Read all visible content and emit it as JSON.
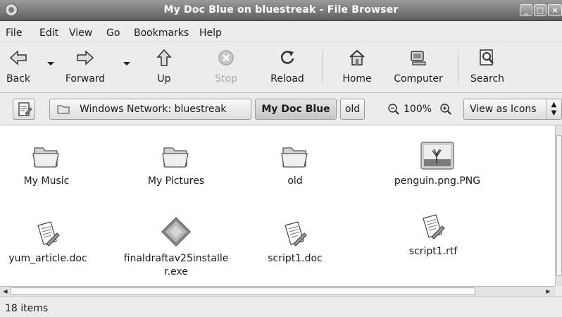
{
  "window": {
    "title": "My Doc Blue on bluestreak - File Browser"
  },
  "menubar": {
    "items": [
      "File",
      "Edit",
      "View",
      "Go",
      "Bookmarks",
      "Help"
    ]
  },
  "toolbar": {
    "back": "Back",
    "forward": "Forward",
    "up": "Up",
    "stop": "Stop",
    "reload": "Reload",
    "home": "Home",
    "computer": "Computer",
    "search": "Search"
  },
  "location": {
    "crumbs": [
      "Windows Network: bluestreak",
      "My Doc Blue",
      "old"
    ],
    "active_crumb": "My Doc Blue",
    "zoom": "100%",
    "view_mode": "View as Icons"
  },
  "files": [
    {
      "name": "My Music",
      "icon": "folder-icon"
    },
    {
      "name": "My Pictures",
      "icon": "folder-icon"
    },
    {
      "name": "old",
      "icon": "folder-icon"
    },
    {
      "name": "penguin.png.PNG",
      "icon": "image-thumbnail-icon"
    },
    {
      "name": "yum_article.doc",
      "icon": "document-icon"
    },
    {
      "name": "finaldraftav25installe",
      "name2": "r.exe",
      "icon": "executable-icon"
    },
    {
      "name": "script1.doc",
      "icon": "document-icon"
    },
    {
      "name": "script1.rtf",
      "icon": "document-icon"
    }
  ],
  "status": {
    "text": "18 items"
  }
}
